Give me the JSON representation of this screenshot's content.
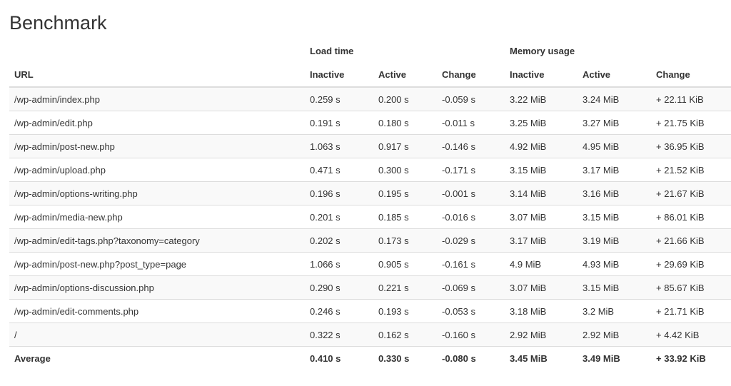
{
  "page": {
    "title": "Benchmark"
  },
  "table": {
    "groups": {
      "load_time": "Load time",
      "memory_usage": "Memory usage"
    },
    "columns": {
      "url": "URL",
      "load_inactive": "Inactive",
      "load_active": "Active",
      "load_change": "Change",
      "mem_inactive": "Inactive",
      "mem_active": "Active",
      "mem_change": "Change"
    },
    "rows": [
      {
        "url": "/wp-admin/index.php",
        "load_inactive": "0.259 s",
        "load_active": "0.200 s",
        "load_change": "-0.059 s",
        "mem_inactive": "3.22 MiB",
        "mem_active": "3.24 MiB",
        "mem_change": "+ 22.11 KiB"
      },
      {
        "url": "/wp-admin/edit.php",
        "load_inactive": "0.191 s",
        "load_active": "0.180 s",
        "load_change": "-0.011 s",
        "mem_inactive": "3.25 MiB",
        "mem_active": "3.27 MiB",
        "mem_change": "+ 21.75 KiB"
      },
      {
        "url": "/wp-admin/post-new.php",
        "load_inactive": "1.063 s",
        "load_active": "0.917 s",
        "load_change": "-0.146 s",
        "mem_inactive": "4.92 MiB",
        "mem_active": "4.95 MiB",
        "mem_change": "+ 36.95 KiB"
      },
      {
        "url": "/wp-admin/upload.php",
        "load_inactive": "0.471 s",
        "load_active": "0.300 s",
        "load_change": "-0.171 s",
        "mem_inactive": "3.15 MiB",
        "mem_active": "3.17 MiB",
        "mem_change": "+ 21.52 KiB"
      },
      {
        "url": "/wp-admin/options-writing.php",
        "load_inactive": "0.196 s",
        "load_active": "0.195 s",
        "load_change": "-0.001 s",
        "mem_inactive": "3.14 MiB",
        "mem_active": "3.16 MiB",
        "mem_change": "+ 21.67 KiB"
      },
      {
        "url": "/wp-admin/media-new.php",
        "load_inactive": "0.201 s",
        "load_active": "0.185 s",
        "load_change": "-0.016 s",
        "mem_inactive": "3.07 MiB",
        "mem_active": "3.15 MiB",
        "mem_change": "+ 86.01 KiB"
      },
      {
        "url": "/wp-admin/edit-tags.php?taxonomy=category",
        "load_inactive": "0.202 s",
        "load_active": "0.173 s",
        "load_change": "-0.029 s",
        "mem_inactive": "3.17 MiB",
        "mem_active": "3.19 MiB",
        "mem_change": "+ 21.66 KiB"
      },
      {
        "url": "/wp-admin/post-new.php?post_type=page",
        "load_inactive": "1.066 s",
        "load_active": "0.905 s",
        "load_change": "-0.161 s",
        "mem_inactive": "4.9 MiB",
        "mem_active": "4.93 MiB",
        "mem_change": "+ 29.69 KiB"
      },
      {
        "url": "/wp-admin/options-discussion.php",
        "load_inactive": "0.290 s",
        "load_active": "0.221 s",
        "load_change": "-0.069 s",
        "mem_inactive": "3.07 MiB",
        "mem_active": "3.15 MiB",
        "mem_change": "+ 85.67 KiB"
      },
      {
        "url": "/wp-admin/edit-comments.php",
        "load_inactive": "0.246 s",
        "load_active": "0.193 s",
        "load_change": "-0.053 s",
        "mem_inactive": "3.18 MiB",
        "mem_active": "3.2 MiB",
        "mem_change": "+ 21.71 KiB"
      },
      {
        "url": "/",
        "load_inactive": "0.322 s",
        "load_active": "0.162 s",
        "load_change": "-0.160 s",
        "mem_inactive": "2.92 MiB",
        "mem_active": "2.92 MiB",
        "mem_change": "+ 4.42 KiB"
      }
    ],
    "average": {
      "url": "Average",
      "load_inactive": "0.410 s",
      "load_active": "0.330 s",
      "load_change": "-0.080 s",
      "mem_inactive": "3.45 MiB",
      "mem_active": "3.49 MiB",
      "mem_change": "+ 33.92 KiB"
    }
  }
}
